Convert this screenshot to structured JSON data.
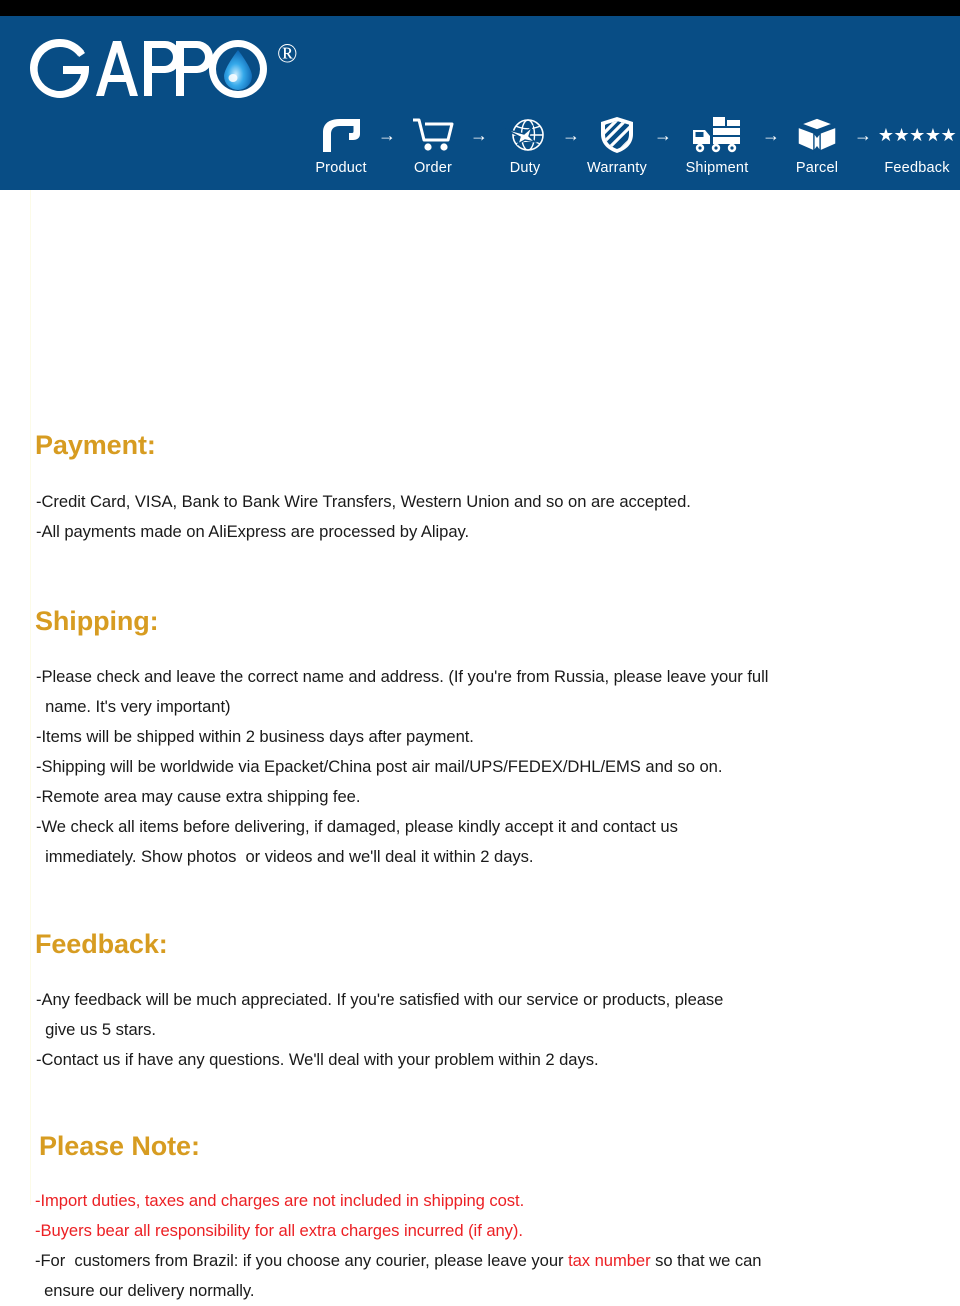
{
  "page": {
    "background_color": "#ffffff",
    "top_strip_color": "#000000"
  },
  "header": {
    "background_color": "#084D85",
    "brand": {
      "name": "GAPPO",
      "registered_mark": "®",
      "droplet_icon": "water-droplet-icon",
      "droplet_color": "#1E9BE0"
    },
    "flow": {
      "arrow": "→",
      "steps": [
        {
          "label": "Product",
          "icon": "faucet-icon"
        },
        {
          "label": "Order",
          "icon": "shopping-cart-icon"
        },
        {
          "label": "Duty",
          "icon": "globe-airplane-icon"
        },
        {
          "label": "Warranty",
          "icon": "shield-icon"
        },
        {
          "label": "Shipment",
          "icon": "delivery-truck-icon"
        },
        {
          "label": "Parcel",
          "icon": "open-box-icon"
        },
        {
          "label": "Feedback",
          "icon": "five-stars-icon",
          "stars": "★★★★★"
        }
      ]
    }
  },
  "colors": {
    "heading": "#D79C21",
    "body_text": "#1a1a1a",
    "alert_red": "#EC2024",
    "brand_blue": "#084D85"
  },
  "sections": {
    "payment": {
      "title": "Payment:",
      "lines": [
        "-Credit Card, VISA, Bank to Bank Wire Transfers, Western Union and so on are accepted.",
        "-All payments made on AliExpress are processed by Alipay."
      ]
    },
    "shipping": {
      "title": "Shipping:",
      "lines": [
        "-Please check and leave the correct name and address. (If you're from Russia, please leave your full",
        "  name. It's very important)",
        "-Items will be shipped within 2 business days after payment.",
        "-Shipping will be worldwide via Epacket/China post air mail/UPS/FEDEX/DHL/EMS and so on.",
        "-Remote area may cause extra shipping fee.",
        "-We check all items before delivering, if damaged, please kindly accept it and contact us",
        "  immediately. Show photos  or videos and we'll deal it within 2 days."
      ]
    },
    "feedback": {
      "title": "Feedback:",
      "lines": [
        "-Any feedback will be much appreciated. If you're satisfied with our service or products, please",
        "  give us 5 stars.",
        "-Contact us if have any questions. We'll deal with your problem within 2 days."
      ]
    },
    "please_note": {
      "title": "Please Note:",
      "lines": [
        {
          "text": "-Import duties, taxes and charges are not included in shipping cost.",
          "color": "red"
        },
        {
          "text": "-Buyers bear all responsibility for all extra charges incurred (if any).",
          "color": "red"
        },
        {
          "pre": "-For  customers from Brazil: if you choose any courier, please leave your ",
          "highlight": "tax number",
          "post": " so that we can",
          "color": "mixed"
        },
        {
          "text": "  ensure our delivery normally.",
          "color": "black"
        }
      ]
    }
  }
}
